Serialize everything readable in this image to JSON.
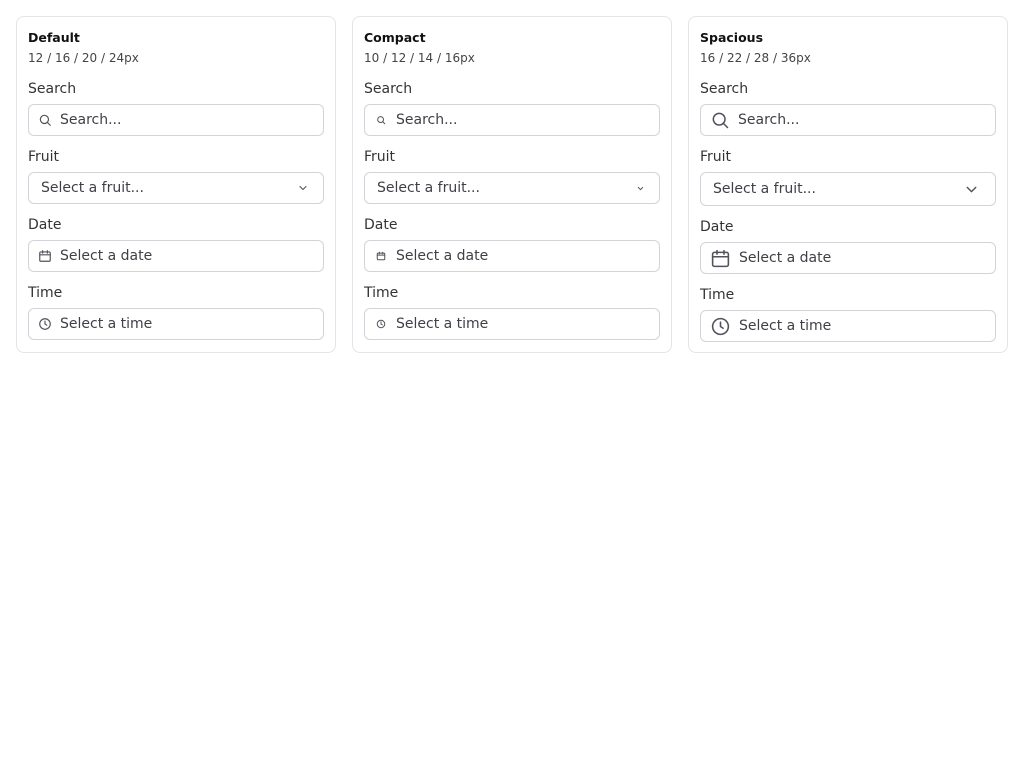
{
  "cards": [
    {
      "variant": "default",
      "title": "Default",
      "subtitle": "12 / 16 / 20 / 24px",
      "search": {
        "label": "Search",
        "placeholder": "Search..."
      },
      "fruit": {
        "label": "Fruit",
        "placeholder": "Select a fruit..."
      },
      "date": {
        "label": "Date",
        "placeholder": "Select a date"
      },
      "time": {
        "label": "Time",
        "placeholder": "Select a time"
      }
    },
    {
      "variant": "compact",
      "title": "Compact",
      "subtitle": "10 / 12 / 14 / 16px",
      "search": {
        "label": "Search",
        "placeholder": "Search..."
      },
      "fruit": {
        "label": "Fruit",
        "placeholder": "Select a fruit..."
      },
      "date": {
        "label": "Date",
        "placeholder": "Select a date"
      },
      "time": {
        "label": "Time",
        "placeholder": "Select a time"
      }
    },
    {
      "variant": "spacious",
      "title": "Spacious",
      "subtitle": "16 / 22 / 28 / 36px",
      "search": {
        "label": "Search",
        "placeholder": "Search..."
      },
      "fruit": {
        "label": "Fruit",
        "placeholder": "Select a fruit..."
      },
      "date": {
        "label": "Date",
        "placeholder": "Select a date"
      },
      "time": {
        "label": "Time",
        "placeholder": "Select a time"
      }
    }
  ],
  "icons": {
    "search": "search-icon",
    "chevron": "chevron-down-icon",
    "calendar": "calendar-icon",
    "clock": "clock-icon"
  },
  "colors": {
    "border": "#d4d4d8",
    "card_border": "#e4e4e7",
    "icon": "#52525b",
    "text": "#3f3f46"
  }
}
